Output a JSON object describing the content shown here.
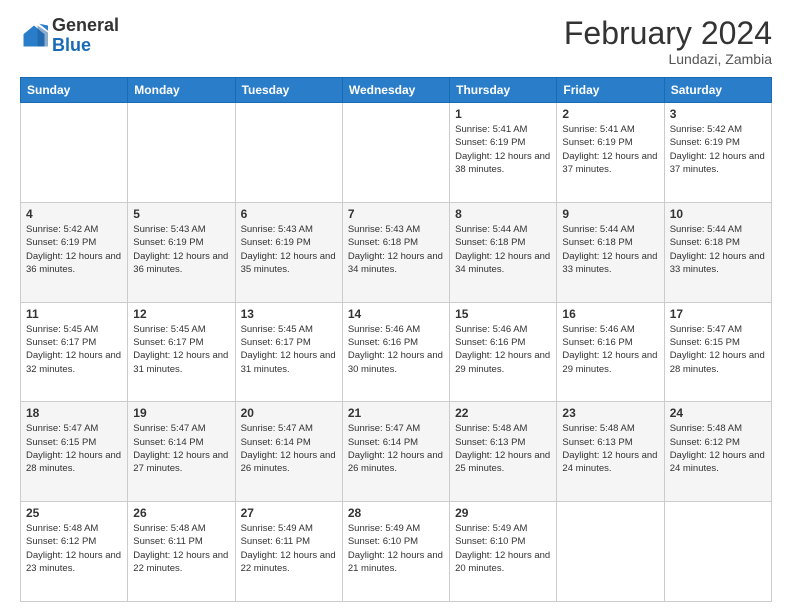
{
  "logo": {
    "general": "General",
    "blue": "Blue"
  },
  "header": {
    "title": "February 2024",
    "subtitle": "Lundazi, Zambia"
  },
  "days_of_week": [
    "Sunday",
    "Monday",
    "Tuesday",
    "Wednesday",
    "Thursday",
    "Friday",
    "Saturday"
  ],
  "weeks": [
    [
      {
        "day": "",
        "info": ""
      },
      {
        "day": "",
        "info": ""
      },
      {
        "day": "",
        "info": ""
      },
      {
        "day": "",
        "info": ""
      },
      {
        "day": "1",
        "info": "Sunrise: 5:41 AM\nSunset: 6:19 PM\nDaylight: 12 hours and 38 minutes."
      },
      {
        "day": "2",
        "info": "Sunrise: 5:41 AM\nSunset: 6:19 PM\nDaylight: 12 hours and 37 minutes."
      },
      {
        "day": "3",
        "info": "Sunrise: 5:42 AM\nSunset: 6:19 PM\nDaylight: 12 hours and 37 minutes."
      }
    ],
    [
      {
        "day": "4",
        "info": "Sunrise: 5:42 AM\nSunset: 6:19 PM\nDaylight: 12 hours and 36 minutes."
      },
      {
        "day": "5",
        "info": "Sunrise: 5:43 AM\nSunset: 6:19 PM\nDaylight: 12 hours and 36 minutes."
      },
      {
        "day": "6",
        "info": "Sunrise: 5:43 AM\nSunset: 6:19 PM\nDaylight: 12 hours and 35 minutes."
      },
      {
        "day": "7",
        "info": "Sunrise: 5:43 AM\nSunset: 6:18 PM\nDaylight: 12 hours and 34 minutes."
      },
      {
        "day": "8",
        "info": "Sunrise: 5:44 AM\nSunset: 6:18 PM\nDaylight: 12 hours and 34 minutes."
      },
      {
        "day": "9",
        "info": "Sunrise: 5:44 AM\nSunset: 6:18 PM\nDaylight: 12 hours and 33 minutes."
      },
      {
        "day": "10",
        "info": "Sunrise: 5:44 AM\nSunset: 6:18 PM\nDaylight: 12 hours and 33 minutes."
      }
    ],
    [
      {
        "day": "11",
        "info": "Sunrise: 5:45 AM\nSunset: 6:17 PM\nDaylight: 12 hours and 32 minutes."
      },
      {
        "day": "12",
        "info": "Sunrise: 5:45 AM\nSunset: 6:17 PM\nDaylight: 12 hours and 31 minutes."
      },
      {
        "day": "13",
        "info": "Sunrise: 5:45 AM\nSunset: 6:17 PM\nDaylight: 12 hours and 31 minutes."
      },
      {
        "day": "14",
        "info": "Sunrise: 5:46 AM\nSunset: 6:16 PM\nDaylight: 12 hours and 30 minutes."
      },
      {
        "day": "15",
        "info": "Sunrise: 5:46 AM\nSunset: 6:16 PM\nDaylight: 12 hours and 29 minutes."
      },
      {
        "day": "16",
        "info": "Sunrise: 5:46 AM\nSunset: 6:16 PM\nDaylight: 12 hours and 29 minutes."
      },
      {
        "day": "17",
        "info": "Sunrise: 5:47 AM\nSunset: 6:15 PM\nDaylight: 12 hours and 28 minutes."
      }
    ],
    [
      {
        "day": "18",
        "info": "Sunrise: 5:47 AM\nSunset: 6:15 PM\nDaylight: 12 hours and 28 minutes."
      },
      {
        "day": "19",
        "info": "Sunrise: 5:47 AM\nSunset: 6:14 PM\nDaylight: 12 hours and 27 minutes."
      },
      {
        "day": "20",
        "info": "Sunrise: 5:47 AM\nSunset: 6:14 PM\nDaylight: 12 hours and 26 minutes."
      },
      {
        "day": "21",
        "info": "Sunrise: 5:47 AM\nSunset: 6:14 PM\nDaylight: 12 hours and 26 minutes."
      },
      {
        "day": "22",
        "info": "Sunrise: 5:48 AM\nSunset: 6:13 PM\nDaylight: 12 hours and 25 minutes."
      },
      {
        "day": "23",
        "info": "Sunrise: 5:48 AM\nSunset: 6:13 PM\nDaylight: 12 hours and 24 minutes."
      },
      {
        "day": "24",
        "info": "Sunrise: 5:48 AM\nSunset: 6:12 PM\nDaylight: 12 hours and 24 minutes."
      }
    ],
    [
      {
        "day": "25",
        "info": "Sunrise: 5:48 AM\nSunset: 6:12 PM\nDaylight: 12 hours and 23 minutes."
      },
      {
        "day": "26",
        "info": "Sunrise: 5:48 AM\nSunset: 6:11 PM\nDaylight: 12 hours and 22 minutes."
      },
      {
        "day": "27",
        "info": "Sunrise: 5:49 AM\nSunset: 6:11 PM\nDaylight: 12 hours and 22 minutes."
      },
      {
        "day": "28",
        "info": "Sunrise: 5:49 AM\nSunset: 6:10 PM\nDaylight: 12 hours and 21 minutes."
      },
      {
        "day": "29",
        "info": "Sunrise: 5:49 AM\nSunset: 6:10 PM\nDaylight: 12 hours and 20 minutes."
      },
      {
        "day": "",
        "info": ""
      },
      {
        "day": "",
        "info": ""
      }
    ]
  ]
}
